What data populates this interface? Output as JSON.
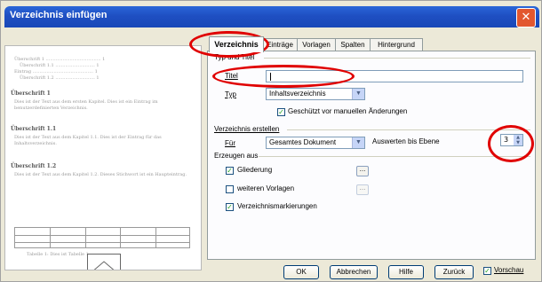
{
  "window": {
    "title": "Verzeichnis einfügen",
    "close_glyph": "✕"
  },
  "tabs": [
    {
      "label": "Verzeichnis",
      "active": true
    },
    {
      "label": "Einträge",
      "active": false
    },
    {
      "label": "Vorlagen",
      "active": false
    },
    {
      "label": "Spalten",
      "active": false
    },
    {
      "label": "Hintergrund",
      "active": false
    }
  ],
  "typ_und_titel": {
    "section_label": "Typ und Titel",
    "titel_label": "Titel",
    "titel_value": "",
    "typ_label": "Typ",
    "typ_value": "Inhaltsverzeichnis",
    "geschuetzt_label": "Geschützt vor manuellen Änderungen",
    "geschuetzt_checked": true
  },
  "verzeichnis_erstellen": {
    "section_label": "Verzeichnis erstellen",
    "fuer_label": "Für",
    "fuer_value": "Gesamtes Dokument",
    "ebene_label": "Auswerten bis Ebene",
    "ebene_value": "3"
  },
  "erzeugen_aus": {
    "section_label": "Erzeugen aus",
    "gliederung_label": "Gliederung",
    "gliederung_checked": true,
    "weitere_label": "weiteren Vorlagen",
    "weitere_checked": false,
    "markierungen_label": "Verzeichnismarkierungen",
    "markierungen_checked": true,
    "more_button": "..."
  },
  "buttons": {
    "ok": "OK",
    "abbrechen": "Abbrechen",
    "hilfe": "Hilfe",
    "zurueck": "Zurück",
    "vorschau_label": "Vorschau",
    "vorschau_checked": true
  },
  "preview": {
    "toc_lines": [
      "Überschrift 1 ....................................... 1",
      "Überschrift 1.1 ............................ 1",
      "Eintrag ........................................... 1",
      "Überschrift 1.2 ............................ 1"
    ],
    "heading1": "Überschrift 1",
    "text1": "Dies ist der Text aus dem ersten Kapitel. Dies ist ein Eintrag im benutzerdefinierten Verzeichnis.",
    "heading2": "Überschrift 1.1",
    "text2": "Dies ist der Text aus dem Kapitel 1.1. Dies ist der Eintrag für das Inhaltsverzeichnis.",
    "heading3": "Überschrift 1.2",
    "text3": "Dies ist der Text aus dem Kapitel 1.2. Dieses Stichwort ist ein Haupteintrag.",
    "caption": "Tabelle 1: Dies ist Tabelle 1"
  },
  "colors": {
    "titlebar": "#1f4fc2",
    "highlight": "#e00000",
    "dialog_bg": "#ece9d8"
  }
}
